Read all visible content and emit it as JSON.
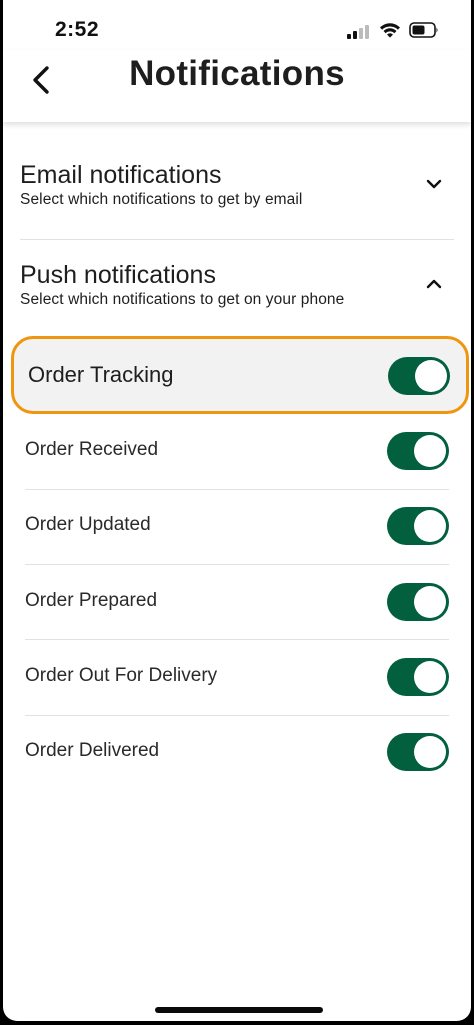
{
  "status_bar": {
    "time": "2:52"
  },
  "header": {
    "title": "Notifications",
    "back_icon": "chevron-left-icon"
  },
  "email_section": {
    "title": "Email notifications",
    "subtitle": "Select which notifications to get by email",
    "expanded": false
  },
  "push_section": {
    "title": "Push notifications",
    "subtitle": "Select which notifications to get on your phone",
    "expanded": true
  },
  "master_toggle": {
    "label": "Order Tracking",
    "on": true
  },
  "push_items": [
    {
      "label": "Order Received",
      "on": true
    },
    {
      "label": "Order Updated",
      "on": true
    },
    {
      "label": "Order Prepared",
      "on": true
    },
    {
      "label": "Order Out For Delivery",
      "on": true
    },
    {
      "label": "Order Delivered",
      "on": true
    }
  ],
  "colors": {
    "toggle_on": "#02603f",
    "highlight_border": "#f0950f"
  }
}
